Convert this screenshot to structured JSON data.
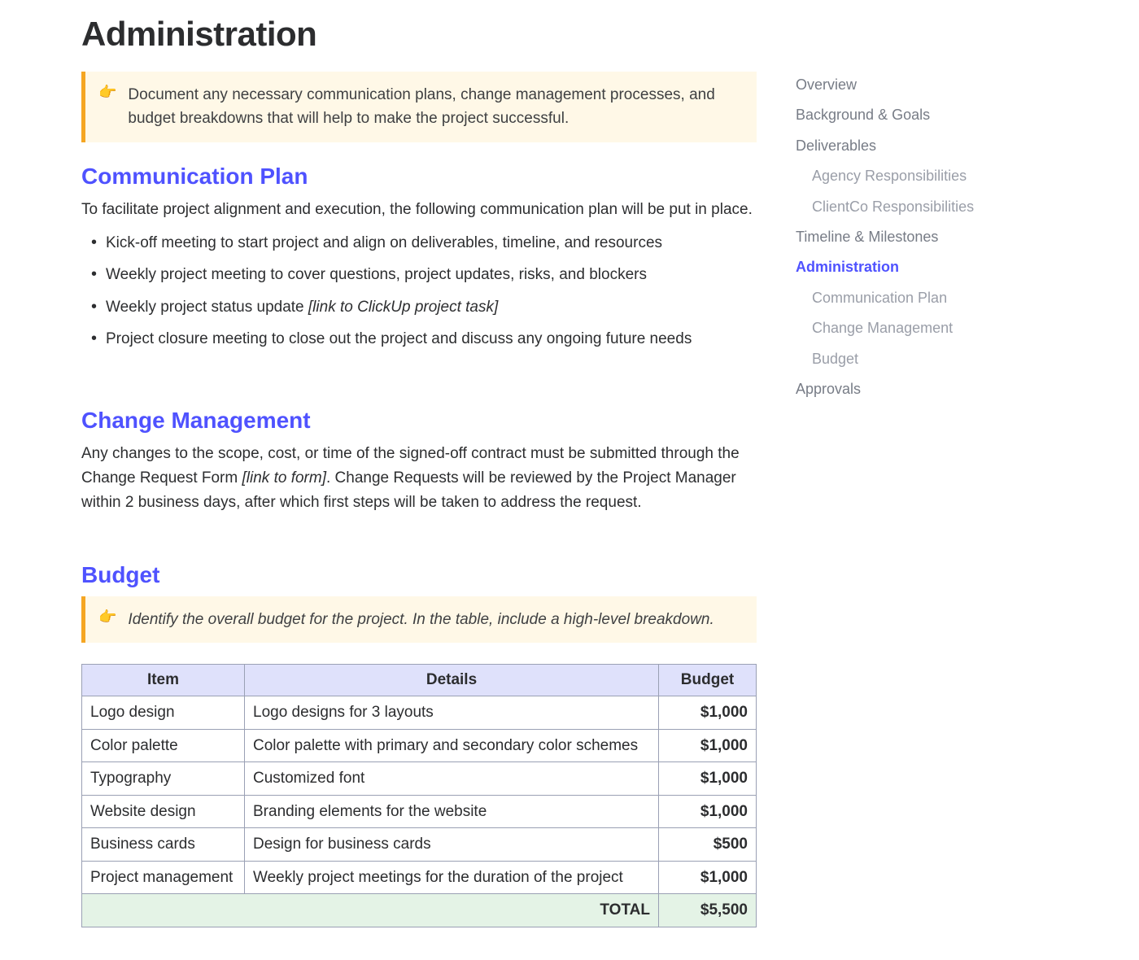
{
  "title": "Administration",
  "callout1": {
    "text": "Document any necessary communication plans, change management processes, and budget breakdowns that will help to make the project successful."
  },
  "comm": {
    "heading": "Communication Plan",
    "intro": "To facilitate project alignment and execution, the following communication plan will be put in place.",
    "items": [
      "Kick-off meeting to start project and align on deliverables, timeline, and resources",
      "Weekly project meeting to cover questions, project updates, risks, and blockers",
      "Weekly project status update ",
      "Project closure meeting to close out the project and discuss any ongoing future needs"
    ],
    "item3_link": "[link to ClickUp project task]"
  },
  "change": {
    "heading": "Change Management",
    "para_pre": "Any changes to the scope, cost, or time of the signed-off contract must be submitted through the Change Request Form ",
    "link": "[link to form]",
    "para_post": ". Change Requests will be reviewed by the Project Manager within 2 business days, after which first steps will be taken to address the request."
  },
  "budget": {
    "heading": "Budget",
    "callout": "Identify the overall budget for the project. In the table, include a high-level breakdown.",
    "cols": [
      "Item",
      "Details",
      "Budget"
    ],
    "rows": [
      {
        "item": "Logo design",
        "details": "Logo designs for 3 layouts",
        "amount": "$1,000"
      },
      {
        "item": "Color palette",
        "details": "Color palette with primary and secondary color schemes",
        "amount": "$1,000"
      },
      {
        "item": "Typography",
        "details": "Customized font",
        "amount": "$1,000"
      },
      {
        "item": "Website design",
        "details": "Branding elements for the website",
        "amount": "$1,000"
      },
      {
        "item": "Business cards",
        "details": "Design for business cards",
        "amount": "$500"
      },
      {
        "item": "Project management",
        "details": "Weekly project meetings for the duration of the project",
        "amount": "$1,000"
      }
    ],
    "total_label": "TOTAL",
    "total_amount": "$5,500"
  },
  "toc": [
    {
      "label": "Overview",
      "sub": false,
      "active": false
    },
    {
      "label": "Background & Goals",
      "sub": false,
      "active": false
    },
    {
      "label": "Deliverables",
      "sub": false,
      "active": false
    },
    {
      "label": "Agency Responsibilities",
      "sub": true,
      "active": false
    },
    {
      "label": "ClientCo Responsibilities",
      "sub": true,
      "active": false
    },
    {
      "label": "Timeline & Milestones",
      "sub": false,
      "active": false
    },
    {
      "label": "Administration",
      "sub": false,
      "active": true
    },
    {
      "label": "Communication Plan",
      "sub": true,
      "active": false
    },
    {
      "label": "Change Management",
      "sub": true,
      "active": false
    },
    {
      "label": "Budget",
      "sub": true,
      "active": false
    },
    {
      "label": "Approvals",
      "sub": false,
      "active": false
    }
  ]
}
